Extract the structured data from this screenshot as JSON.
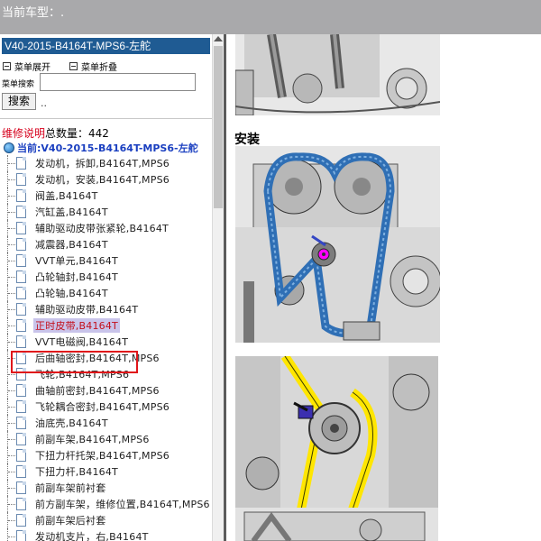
{
  "header": {
    "vehicle_label": "当前车型：."
  },
  "sidebar": {
    "title": "V40-2015-B4164T-MPS6-左舵",
    "expand_label": "菜单展开",
    "collapse_label": "菜单折叠",
    "search_label": "菜单搜索",
    "search_value": "",
    "search_button": "搜索",
    "search_extra": "..",
    "count_label_red": "维修说明",
    "count_label": "总数量：442",
    "current_label": "当前:V40-2015-B4164T-MPS6-左舵",
    "items": [
      {
        "label": "发动机，拆卸,B4164T,MPS6"
      },
      {
        "label": "发动机，安装,B4164T,MPS6"
      },
      {
        "label": "阀盖,B4164T"
      },
      {
        "label": "汽缸盖,B4164T"
      },
      {
        "label": "辅助驱动皮带张紧轮,B4164T"
      },
      {
        "label": "减震器,B4164T"
      },
      {
        "label": "VVT单元,B4164T"
      },
      {
        "label": "凸轮轴封,B4164T"
      },
      {
        "label": "凸轮轴,B4164T"
      },
      {
        "label": "辅助驱动皮带,B4164T"
      },
      {
        "label": "正时皮带,B4164T",
        "selected": true
      },
      {
        "label": "VVT电磁阀,B4164T"
      },
      {
        "label": "后曲轴密封,B4164T,MPS6"
      },
      {
        "label": "飞轮,B4164T,MPS6"
      },
      {
        "label": "曲轴前密封,B4164T,MPS6"
      },
      {
        "label": "飞轮耦合密封,B4164T,MPS6"
      },
      {
        "label": "油底壳,B4164T"
      },
      {
        "label": "前副车架,B4164T,MPS6"
      },
      {
        "label": "下扭力杆托架,B4164T,MPS6"
      },
      {
        "label": "下扭力杆,B4164T"
      },
      {
        "label": "前副车架前衬套"
      },
      {
        "label": "前方副车架，维修位置,B4164T,MPS6"
      },
      {
        "label": "前副车架后衬套"
      },
      {
        "label": "发动机支片，右,B4164T"
      }
    ]
  },
  "content": {
    "section_heading": "安装"
  },
  "colors": {
    "title_bar": "#1f5b93",
    "selection_border": "#e0161a",
    "belt_blue": "#2f6fb5",
    "belt_yellow": "#ffe600",
    "tensioner_magenta": "#ff00ff"
  }
}
